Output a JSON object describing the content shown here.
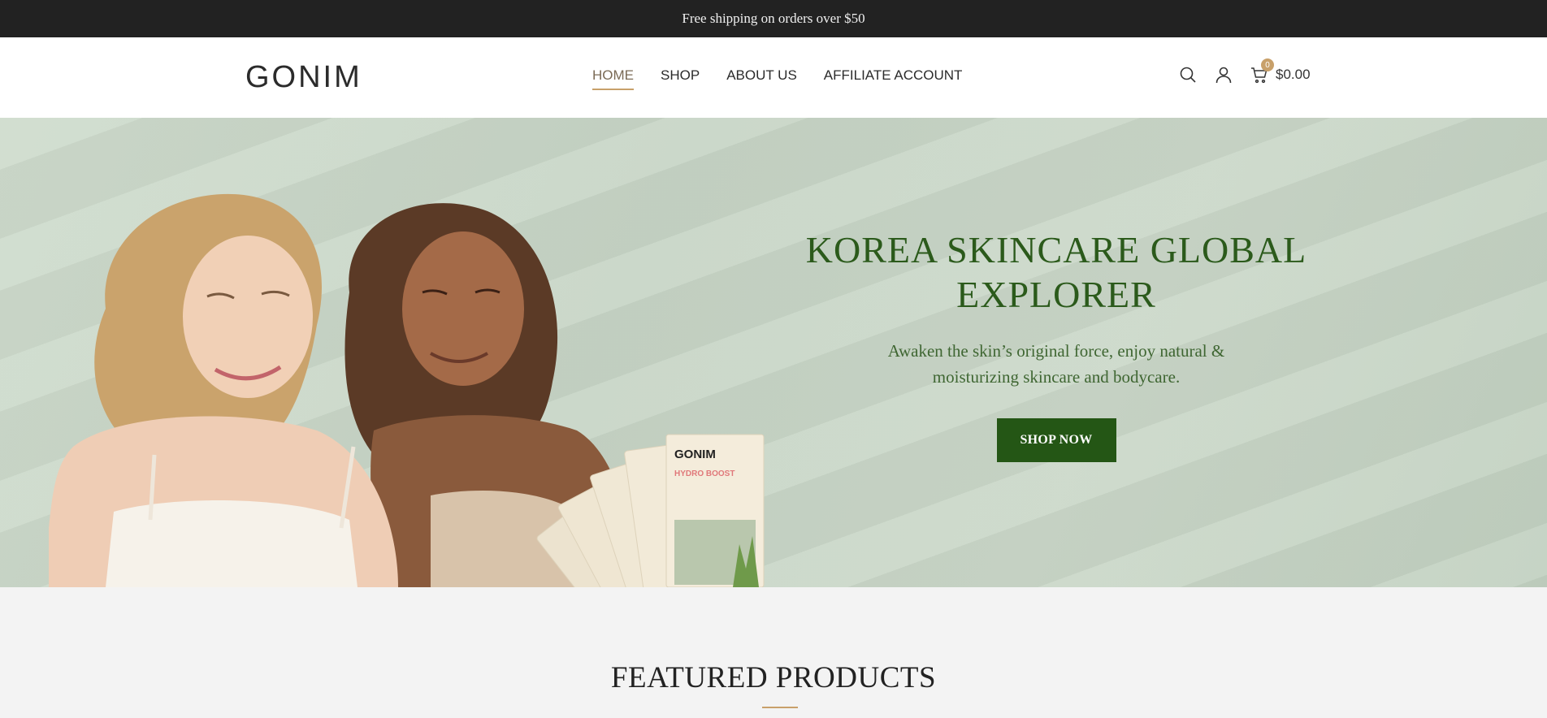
{
  "topbar": {
    "text": "Free shipping on orders over $50"
  },
  "header": {
    "logo": "GONIM",
    "nav": [
      {
        "label": "HOME",
        "active": true
      },
      {
        "label": "SHOP",
        "active": false
      },
      {
        "label": "ABOUT US",
        "active": false
      },
      {
        "label": "AFFILIATE ACCOUNT",
        "active": false
      }
    ],
    "icons": [
      "search-icon",
      "user-icon",
      "cart-icon"
    ],
    "cart": {
      "count": "0",
      "total": "$0.00"
    }
  },
  "hero": {
    "title": "KOREA SKINCARE GLOBAL EXPLORER",
    "subtitle": "Awaken the skin’s original force, enjoy natural & moisturizing skincare and bodycare.",
    "cta": "SHOP NOW",
    "packet_brand": "GONIM",
    "packet_product": "HYDRO BOOST"
  },
  "featured": {
    "title": "FEATURED PRODUCTS"
  },
  "colors": {
    "topbar_bg": "#222222",
    "accent": "#c8a06a",
    "hero_bg": "#c9d7c8",
    "hero_text": "#2b5a1b",
    "button_bg": "#245615"
  }
}
